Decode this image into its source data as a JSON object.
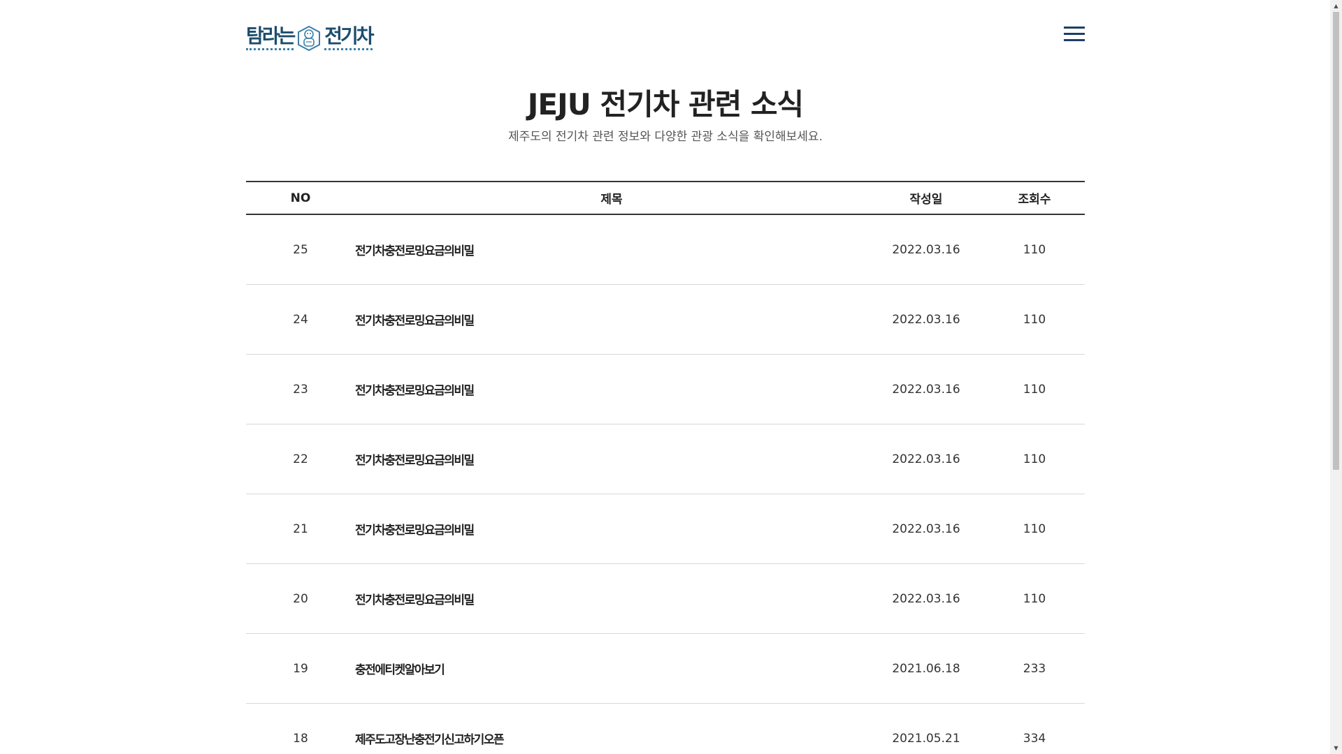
{
  "header": {
    "logo_text_left": "탐라는",
    "logo_text_right": "전기차",
    "menu_icon": "hamburger-menu-icon"
  },
  "intro": {
    "title": "JEJU 전기차 관련 소식",
    "subtitle": "제주도의 전기차 관련 정보와 다양한 관광 소식을 확인해보세요."
  },
  "board": {
    "columns": {
      "no": "NO",
      "title": "제목",
      "date": "작성일",
      "views": "조회수"
    },
    "rows": [
      {
        "no": "25",
        "title": "전기차충전로밍요금의비밀",
        "date": "2022.03.16",
        "views": "110"
      },
      {
        "no": "24",
        "title": "전기차충전로밍요금의비밀",
        "date": "2022.03.16",
        "views": "110"
      },
      {
        "no": "23",
        "title": "전기차충전로밍요금의비밀",
        "date": "2022.03.16",
        "views": "110"
      },
      {
        "no": "22",
        "title": "전기차충전로밍요금의비밀",
        "date": "2022.03.16",
        "views": "110"
      },
      {
        "no": "21",
        "title": "전기차충전로밍요금의비밀",
        "date": "2022.03.16",
        "views": "110"
      },
      {
        "no": "20",
        "title": "전기차충전로밍요금의비밀",
        "date": "2022.03.16",
        "views": "110"
      },
      {
        "no": "19",
        "title": "충전에티켓알아보기",
        "date": "2021.06.18",
        "views": "233"
      },
      {
        "no": "18",
        "title": "제주도고장난충전기신고하기오픈",
        "date": "2021.05.21",
        "views": "334"
      }
    ]
  },
  "colors": {
    "logo": "#1c4d6d",
    "menu": "#1c3f66",
    "border_strong": "#333333",
    "border_light": "#d8d8d8"
  }
}
